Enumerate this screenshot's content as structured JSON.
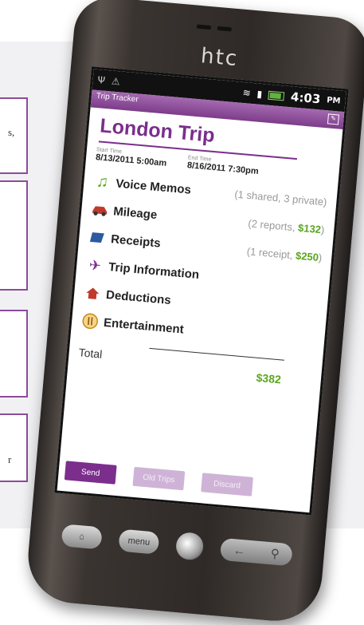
{
  "callouts": [
    {
      "fragment": "s,"
    },
    {
      "fragment": ""
    },
    {
      "fragment": ""
    },
    {
      "fragment": "r"
    }
  ],
  "phone": {
    "brand": "htc",
    "status": {
      "time": "4:03",
      "ampm": "PM"
    }
  },
  "app": {
    "name": "Trip Tracker",
    "trip_title": "London Trip",
    "start": {
      "caption": "Start Time",
      "value": "8/13/2011 5:00am"
    },
    "end": {
      "caption": "End Time",
      "value": "8/16/2011 7:30pm"
    },
    "items": [
      {
        "label": "Voice Memos",
        "meta": "(1 shared, 3 private)",
        "icon": "music-note-icon",
        "color": "#5aa51e"
      },
      {
        "label": "Mileage",
        "meta_pre": "(2 reports, ",
        "money": "$132",
        "meta_post": ")",
        "icon": "car-icon",
        "color": "#c0392b"
      },
      {
        "label": "Receipts",
        "meta_pre": "(1 receipt, ",
        "money": "$250",
        "meta_post": ")",
        "icon": "receipt-icon",
        "color": "#2c5aa0"
      },
      {
        "label": "Trip Information",
        "icon": "airplane-icon",
        "color": "#7b2e8c"
      },
      {
        "label": "Deductions",
        "icon": "house-icon",
        "color": "#c0392b"
      },
      {
        "label": "Entertainment",
        "icon": "fork-knife-icon",
        "color": "#d98c1a"
      }
    ],
    "total_label": "Total",
    "total_value": "$382",
    "buttons": {
      "send": "Send",
      "old_trips": "Old Trips",
      "discard": "Discard"
    }
  },
  "hardware": {
    "menu": "menu"
  },
  "colors": {
    "accent": "#7b2e8c",
    "money": "#5aa51e"
  }
}
